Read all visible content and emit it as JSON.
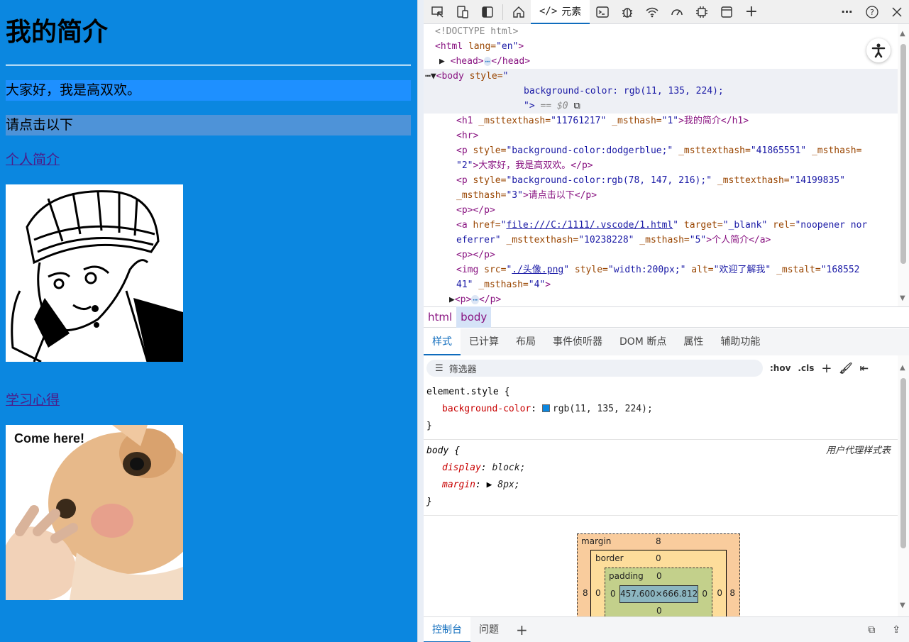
{
  "page": {
    "heading": "我的简介",
    "para1": "大家好，我是高双欢。",
    "para2": "请点击以下",
    "link1": "个人简介",
    "link2": "学习心得",
    "cat_caption": "Come here!",
    "bg_color": "#0b87e0"
  },
  "devtools": {
    "elements_tab": "元素",
    "dom_lines": {
      "l0": "<!DOCTYPE html>",
      "l1_tag": "<html",
      "l1_attr": " lang=",
      "l1_val": "\"en\"",
      "l1_end": ">",
      "l2": "<head>",
      "l2_end": "</head>",
      "l3_tag": "<body",
      "l3_attr": " style=",
      "l3_val": "\"",
      "l4": "background-color: rgb(11, 135, 224);",
      "l5a": "\">",
      "l5b": " == $0",
      "l6a": "<h1",
      "l6b": " _msttexthash=",
      "l6c": "\"11761217\"",
      "l6d": " _msthash=",
      "l6e": "\"1\"",
      "l6f": ">我的简介</h1>",
      "l7": "<hr>",
      "l8a": "<p",
      "l8b": " style=",
      "l8c": "\"background-color:dodgerblue;\"",
      "l8d": " _msttexthash=",
      "l8e": "\"41865551\"",
      "l8f": " _msthash=",
      "l9a": "\"2\"",
      "l9b": ">大家好，我是高双欢。</p>",
      "l10a": "<p",
      "l10b": " style=",
      "l10c": "\"background-color:rgb(78, 147, 216);\"",
      "l10d": " _msttexthash=",
      "l10e": "\"14199835\"",
      "l11a": "_msthash=",
      "l11b": "\"3\"",
      "l11c": ">请点击以下</p>",
      "l12": "<p></p>",
      "l13a": "<a",
      "l13b": " href=",
      "l13c": "\"",
      "l13d": "file:///C:/1111/.vscode/1.html",
      "l13e": "\"",
      "l13f": " target=",
      "l13g": "\"_blank\"",
      "l13h": " rel=",
      "l13i": "\"noopener nor",
      "l14a": "eferrer\"",
      "l14b": " _msttexthash=",
      "l14c": "\"10238228\"",
      "l14d": " _msthash=",
      "l14e": "\"5\"",
      "l14f": ">个人简介</a>",
      "l15": "<p></p>",
      "l16a": "<img",
      "l16b": " src=",
      "l16c": "\"",
      "l16d": "./头像.png",
      "l16e": "\"",
      "l16f": " style=",
      "l16g": "\"width:200px;\"",
      "l16h": " alt=",
      "l16i": "\"欢迎了解我\"",
      "l16j": " _mstalt=",
      "l16k": "\"168552",
      "l17a": "41\"",
      "l17b": " _msthash=",
      "l17c": "\"4\"",
      "l17d": ">",
      "l18": "<p>",
      "l18b": "</p>"
    },
    "crumbs": [
      "html",
      "body"
    ],
    "subtabs": [
      "样式",
      "已计算",
      "布局",
      "事件侦听器",
      "DOM 断点",
      "属性",
      "辅助功能"
    ],
    "filter_placeholder": "筛选器",
    "hov": ":hov",
    "cls": ".cls",
    "rule1_selector": "element.style {",
    "rule1_prop": "background-color",
    "rule1_val": "rgb(11, 135, 224);",
    "close": "}",
    "rule2_selector": "body {",
    "rule2_source": "用户代理样式表",
    "rule2_p1": "display",
    "rule2_v1": "block;",
    "rule2_p2": "margin",
    "rule2_v2": "8px;",
    "box": {
      "margin_label": "margin",
      "margin": "8",
      "border_label": "border",
      "border": "0",
      "padding_label": "padding",
      "padding": "0",
      "content": "457.600×666.812",
      "left_m": "8",
      "left_b": "0",
      "left_p": "0",
      "right_p": "0",
      "right_b": "0",
      "right_m": "8",
      "bottom_p": "0"
    },
    "bottom_tabs": [
      "控制台",
      "问题"
    ]
  }
}
